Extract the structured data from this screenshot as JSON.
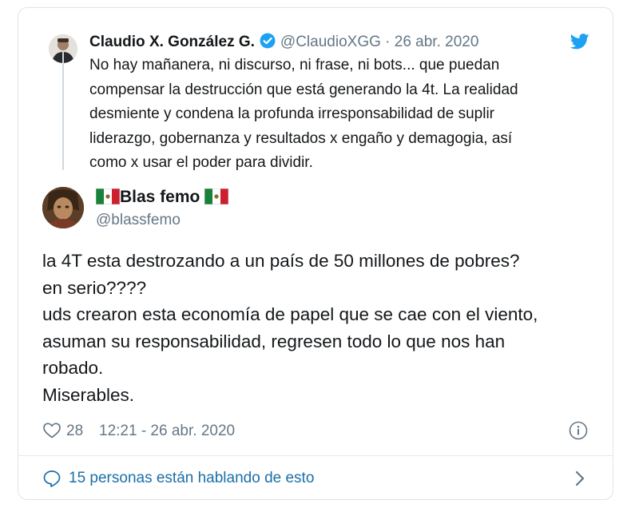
{
  "parent_tweet": {
    "name": "Claudio X. González G.",
    "handle": "@ClaudioXGG",
    "separator": "·",
    "date": "26 abr. 2020",
    "lines": [
      "No hay mañanera, ni discurso, ni frase, ni bots... que puedan",
      "compensar la destrucción que está generando la 4t. La realidad",
      "desmiente y condena la profunda irresponsabilidad de suplir",
      "liderazgo, gobernanza y resultados x engaño y demagogia, así",
      "como x usar el poder para dividir."
    ]
  },
  "main_tweet": {
    "name": "Blas femo",
    "handle": "@blassfemo",
    "lines": [
      "la 4T esta destrozando a un país de 50 millones de pobres?",
      "en serio????",
      "uds crearon esta economía de papel que se cae con el viento,",
      "asuman su responsabilidad, regresen todo lo que nos han",
      "robado.",
      "Miserables."
    ],
    "likes": "28",
    "timestamp": "12:21 - 26 abr. 2020"
  },
  "conversation": {
    "label": "15 personas están hablando de esto"
  },
  "colors": {
    "twitter_blue": "#1da1f2",
    "link_blue": "#1b6fa8",
    "secondary_text": "#657786",
    "primary_text": "#14171a",
    "border": "#dfe4e8"
  },
  "icons": {
    "verified": "verified-badge-icon",
    "twitter": "twitter-bird-icon",
    "flag": "mexico-flag-icon",
    "like": "heart-icon",
    "info": "info-icon",
    "reply": "speech-bubble-icon",
    "more": "chevron-right-icon"
  }
}
